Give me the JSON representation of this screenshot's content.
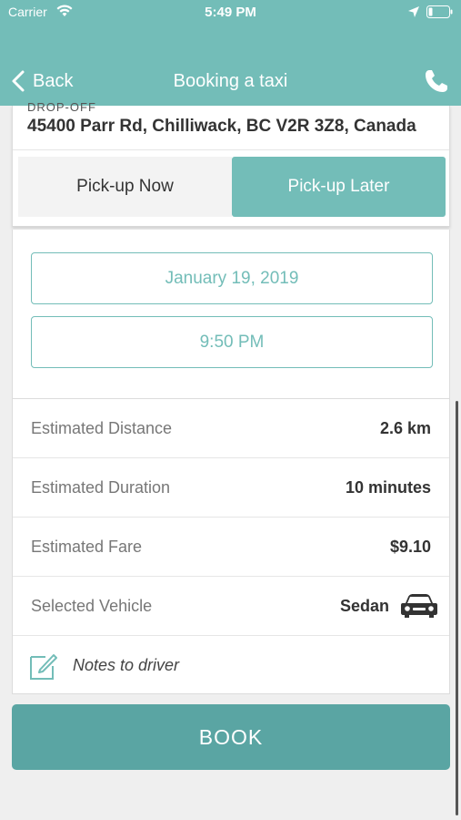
{
  "status_bar": {
    "carrier": "Carrier",
    "time": "5:49 PM"
  },
  "nav": {
    "back_label": "Back",
    "title": "Booking a taxi"
  },
  "dropoff": {
    "label": "DROP-OFF",
    "address": "45400 Parr Rd, Chilliwack, BC V2R 3Z8, Canada"
  },
  "pickup_mode": {
    "options": [
      "Pick-up Now",
      "Pick-up Later"
    ],
    "selected": "Pick-up Later"
  },
  "schedule": {
    "date": "January 19, 2019",
    "time": "9:50 PM"
  },
  "estimates": {
    "distance_label": "Estimated Distance",
    "distance_value": "2.6 km",
    "duration_label": "Estimated Duration",
    "duration_value": "10 minutes",
    "fare_label": "Estimated Fare",
    "fare_value": "$9.10",
    "vehicle_label": "Selected Vehicle",
    "vehicle_value": "Sedan"
  },
  "notes": {
    "label": "Notes to driver"
  },
  "book_button": {
    "label": "BOOK"
  },
  "colors": {
    "accent": "#73bdb8",
    "button": "#5aa5a3"
  }
}
